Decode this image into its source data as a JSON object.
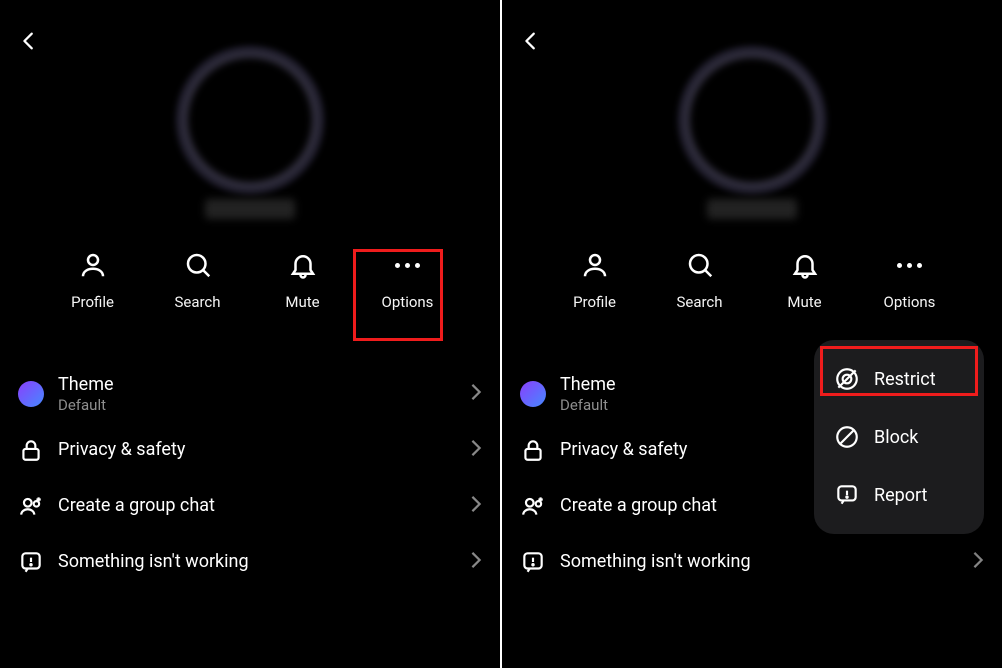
{
  "actions": {
    "profile": "Profile",
    "search": "Search",
    "mute": "Mute",
    "options": "Options"
  },
  "settings": {
    "theme_title": "Theme",
    "theme_sub": "Default",
    "privacy": "Privacy & safety",
    "group": "Create a group chat",
    "working": "Something isn't working"
  },
  "popup": {
    "restrict": "Restrict",
    "block": "Block",
    "report": "Report"
  }
}
